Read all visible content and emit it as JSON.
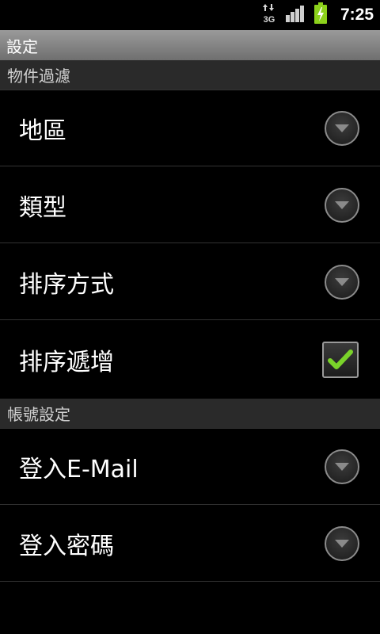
{
  "status_bar": {
    "network_icon": "3g-data-icon",
    "network_label": "3G",
    "signal_icon": "signal-strength-icon",
    "battery_icon": "battery-charging-icon",
    "time": "7:25",
    "colors": {
      "battery": "#8cd11b"
    }
  },
  "title_bar": {
    "title": "設定"
  },
  "sections": {
    "object_filter": {
      "header": "物件過濾",
      "items": {
        "region": {
          "label": "地區",
          "widget": "dropdown"
        },
        "type": {
          "label": "類型",
          "widget": "dropdown"
        },
        "sort_method": {
          "label": "排序方式",
          "widget": "dropdown"
        },
        "sort_increment": {
          "label": "排序遞增",
          "widget": "checkbox",
          "checked": true
        }
      }
    },
    "account_settings": {
      "header": "帳號設定",
      "items": {
        "login_email": {
          "label": "登入E-Mail",
          "widget": "dropdown"
        },
        "login_password": {
          "label": "登入密碼",
          "widget": "dropdown"
        }
      }
    }
  },
  "colors": {
    "check_mark": "#7ad32a",
    "title_bar": "#858585",
    "category_bg": "#2a2a2a"
  }
}
